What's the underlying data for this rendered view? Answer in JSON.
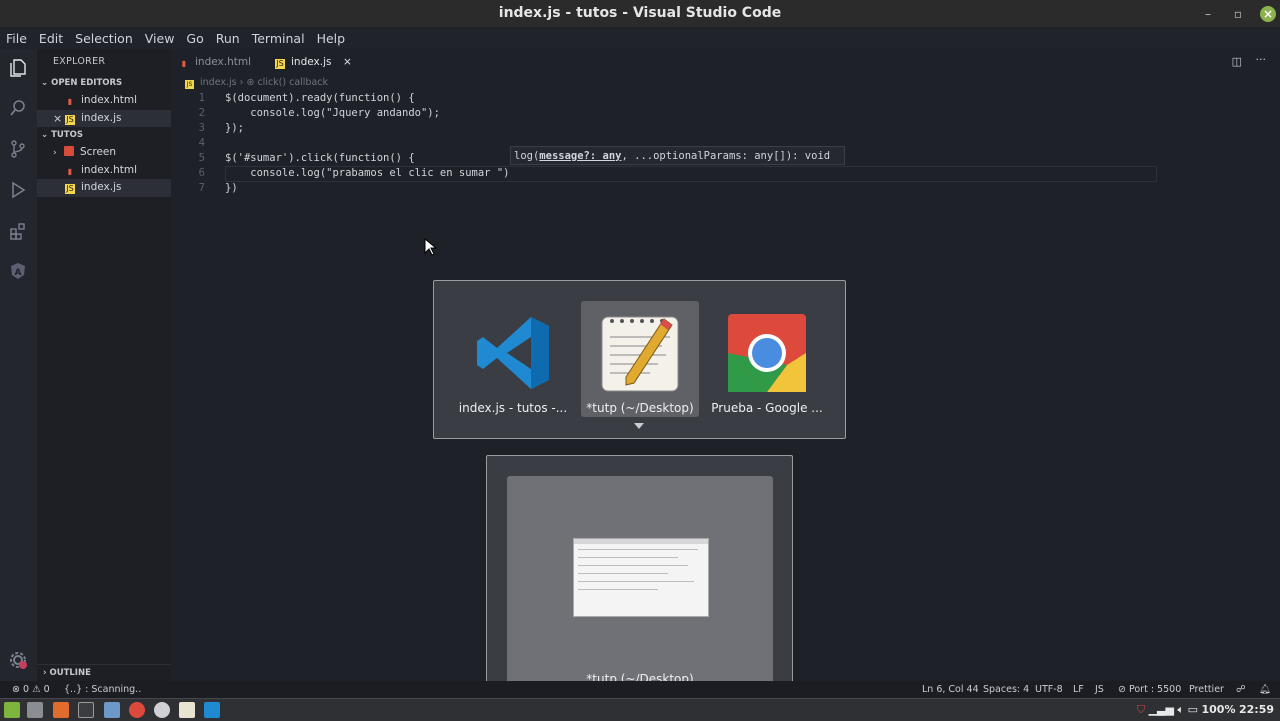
{
  "window": {
    "title": "index.js - tutos - Visual Studio Code"
  },
  "menu": [
    "File",
    "Edit",
    "Selection",
    "View",
    "Go",
    "Run",
    "Terminal",
    "Help"
  ],
  "sidebar": {
    "title": "EXPLORER",
    "open_editors_label": "OPEN EDITORS",
    "open_editors": [
      "index.html",
      "index.js"
    ],
    "folder_label": "TUTOS",
    "tree": [
      "Screen",
      "index.html",
      "index.js"
    ],
    "outline_label": "OUTLINE"
  },
  "tabs": [
    "index.html",
    "index.js"
  ],
  "breadcrumb": {
    "file": "index.js",
    "symbol": "click() callback"
  },
  "code": {
    "line_numbers": [
      "1",
      "2",
      "3",
      "4",
      "5",
      "6",
      "7"
    ],
    "lines": [
      "$(document).ready(function() {",
      "    console.log(\"Jquery andando\");",
      "});",
      "",
      "$('#sumar').click(function() {",
      "    console.log(\"prabamos el clic en sumar \")",
      "})"
    ]
  },
  "hover": {
    "prefix": "log(",
    "param": "message?: any",
    "rest": ", ...optionalParams: any[]): void"
  },
  "switcher": {
    "apps": [
      {
        "label": "index.js - tutos -...",
        "icon": "vscode-icon"
      },
      {
        "label": "*tutp (~/Desktop)",
        "icon": "text-editor-icon"
      },
      {
        "label": "Prueba - Google ...",
        "icon": "chrome-icon"
      }
    ],
    "selected_index": 1,
    "preview_label": "*tutp (~/Desktop)"
  },
  "status": {
    "problems_errors": "0",
    "problems_warnings": "0",
    "scanning": "{..} : Scanning..",
    "position": "Ln 6, Col 44",
    "spaces": "Spaces: 4",
    "encoding": "UTF-8",
    "eol": "LF",
    "language": "JS",
    "port": "Port : 5500",
    "formatter": "Prettier"
  },
  "taskbar": {
    "battery": "100%",
    "time": "22:59"
  },
  "colors": {
    "accent": "#e5a33b",
    "vscode_blue": "#1f8ad2",
    "editor_bg": "#1f2128"
  }
}
